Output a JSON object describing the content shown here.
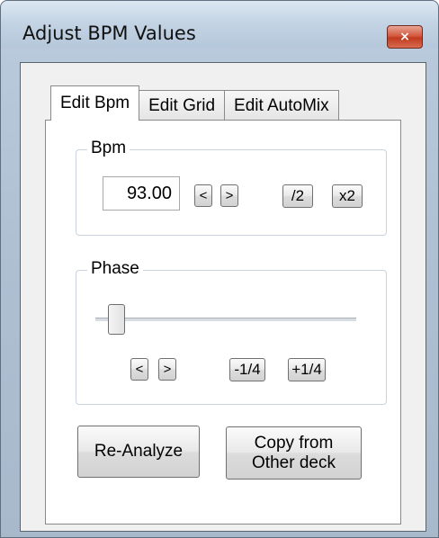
{
  "window": {
    "title": "Adjust BPM Values",
    "close_glyph": "×"
  },
  "tabs": [
    {
      "label": "Edit Bpm",
      "active": true
    },
    {
      "label": "Edit Grid",
      "active": false
    },
    {
      "label": "Edit AutoMix",
      "active": false
    }
  ],
  "bpm_group": {
    "title": "Bpm",
    "value": "93.00",
    "decrease_label": "<",
    "increase_label": ">",
    "half_label": "/2",
    "double_label": "x2"
  },
  "phase_group": {
    "title": "Phase",
    "slider_position": 0.05,
    "decrease_label": "<",
    "increase_label": ">",
    "minus_quarter_label": "-1/4",
    "plus_quarter_label": "+1/4"
  },
  "actions": {
    "reanalyze_label": "Re-Analyze",
    "copy_label_line1": "Copy from",
    "copy_label_line2": "Other deck"
  }
}
